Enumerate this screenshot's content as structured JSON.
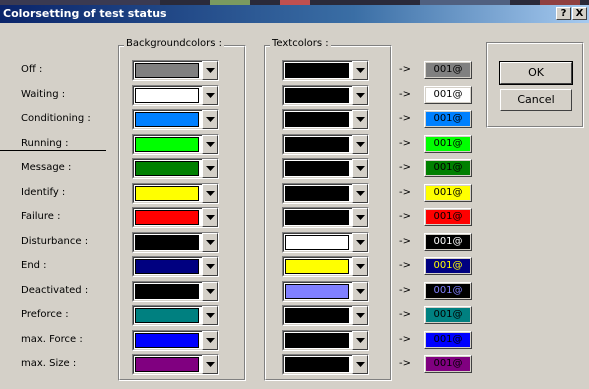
{
  "dialog": {
    "title": "Colorsetting of test status",
    "help_label": "?",
    "close_label": "X"
  },
  "groups": {
    "background_title": "Backgroundcolors :",
    "text_title": "Textcolors :"
  },
  "arrow_text": "->",
  "preview_text": "001@",
  "buttons": {
    "ok": "OK",
    "cancel": "Cancel"
  },
  "statuses": [
    {
      "label": "Off :",
      "bg": "#808080",
      "fg": "#000000"
    },
    {
      "label": "Waiting :",
      "bg": "#ffffff",
      "fg": "#000000"
    },
    {
      "label": "Conditioning :",
      "bg": "#0080ff",
      "fg": "#000000"
    },
    {
      "label": "Running :",
      "bg": "#00ff00",
      "fg": "#000000"
    },
    {
      "label": "Message :",
      "bg": "#008000",
      "fg": "#000000"
    },
    {
      "label": "Identify :",
      "bg": "#ffff00",
      "fg": "#000000"
    },
    {
      "label": "Failure :",
      "bg": "#ff0000",
      "fg": "#000000"
    },
    {
      "label": "Disturbance :",
      "bg": "#000000",
      "fg": "#ffffff"
    },
    {
      "label": "End :",
      "bg": "#000080",
      "fg": "#ffff00"
    },
    {
      "label": "Deactivated :",
      "bg": "#000000",
      "fg": "#8080ff"
    },
    {
      "label": "Preforce :",
      "bg": "#008080",
      "fg": "#000000"
    },
    {
      "label": "max. Force :",
      "bg": "#0000ff",
      "fg": "#000000"
    },
    {
      "label": "max. Size :",
      "bg": "#800080",
      "fg": "#000000"
    }
  ]
}
